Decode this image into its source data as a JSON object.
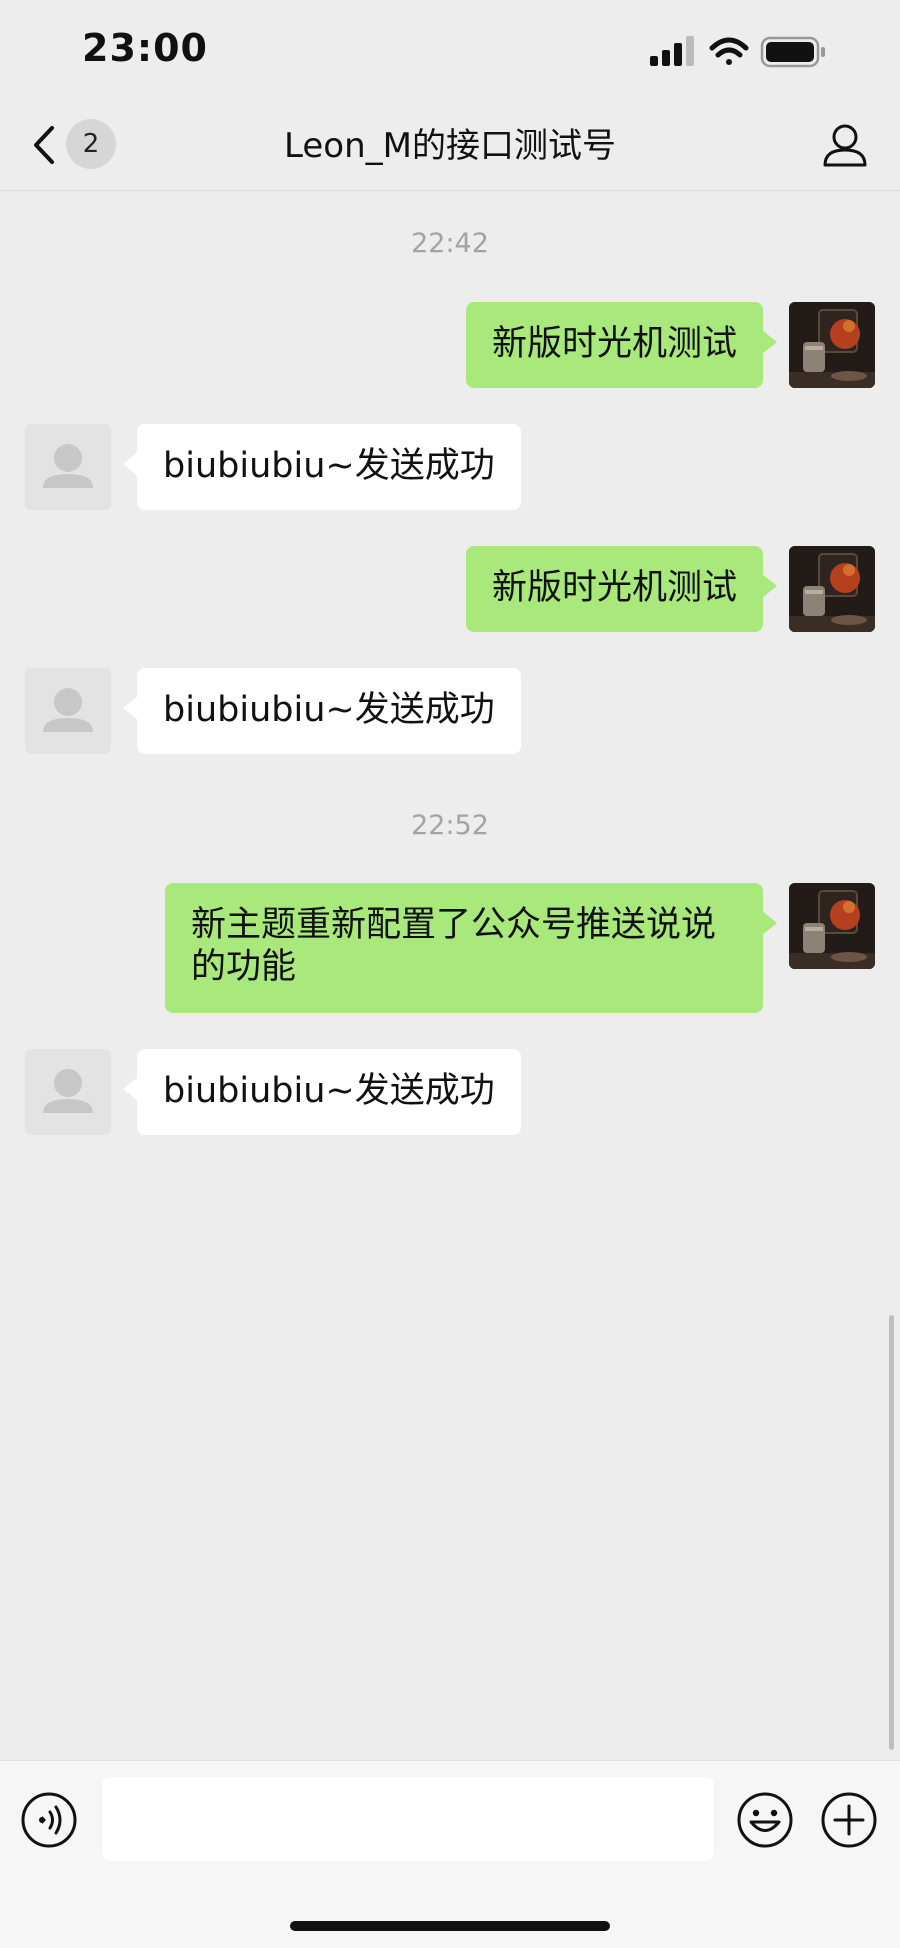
{
  "status_bar": {
    "time": "23:00"
  },
  "nav": {
    "unread_count": "2",
    "title": "Leon_M的接口测试号"
  },
  "messages": [
    {
      "type": "timestamp",
      "text": "22:42"
    },
    {
      "type": "sent",
      "text": "新版时光机测试"
    },
    {
      "type": "received",
      "text": "biubiubiu~发送成功"
    },
    {
      "type": "sent",
      "text": "新版时光机测试"
    },
    {
      "type": "received",
      "text": "biubiubiu~发送成功"
    },
    {
      "type": "timestamp",
      "text": "22:52"
    },
    {
      "type": "sent",
      "text": "新主题重新配置了公众号推送说说\n的功能"
    },
    {
      "type": "received",
      "text": "biubiubiu~发送成功"
    }
  ],
  "input": {
    "value": ""
  },
  "colors": {
    "background": "#ededed",
    "sent_bubble": "#a9e87a",
    "received_bubble": "#ffffff",
    "timestamp_text": "#a3a3a3"
  },
  "icons": {
    "back": "chevron-left-icon",
    "profile": "person-icon",
    "voice": "voice-icon",
    "emoji": "emoji-icon",
    "plus": "plus-icon"
  }
}
